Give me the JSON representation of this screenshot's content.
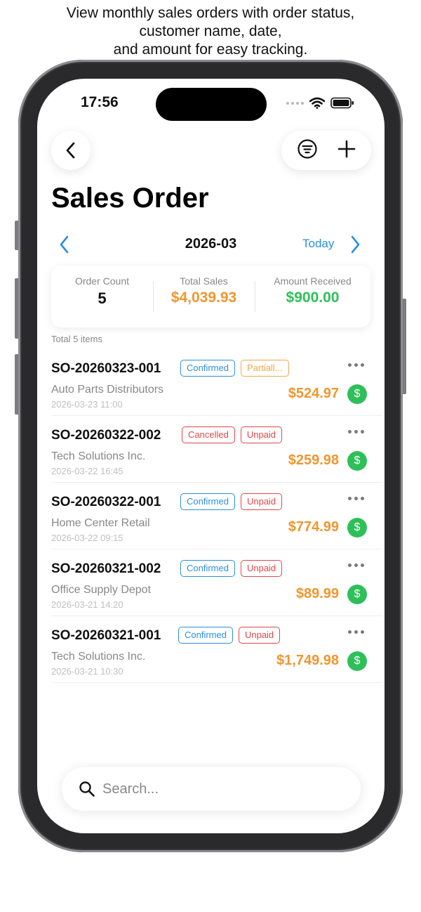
{
  "caption": {
    "line1": "View monthly sales orders with order status,",
    "line2": "customer name, date,",
    "line3": "and amount for easy tracking."
  },
  "status_bar": {
    "time": "17:56",
    "icons": [
      "signal-dots-icon",
      "wifi-icon",
      "battery-icon"
    ]
  },
  "nav": {
    "back_icon": "chevron-left-icon",
    "filter_icon": "filter-icon",
    "add_icon": "plus-icon"
  },
  "page": {
    "title": "Sales Order"
  },
  "month_nav": {
    "label": "2026-03",
    "today": "Today"
  },
  "summary": {
    "order_count_label": "Order Count",
    "order_count": "5",
    "total_sales_label": "Total Sales",
    "total_sales": "$4,039.93",
    "amount_received_label": "Amount Received",
    "amount_received": "$900.00"
  },
  "list": {
    "total": "Total 5 items",
    "orders": [
      {
        "no": "SO-20260323-001",
        "status": "Confirmed",
        "payment": "Partiall...",
        "customer": "Auto Parts Distributors",
        "date": "2026-03-23 11:00",
        "amount": "$524.97"
      },
      {
        "no": "SO-20260322-002",
        "status": "Cancelled",
        "payment": "Unpaid",
        "customer": "Tech Solutions Inc.",
        "date": "2026-03-22 16:45",
        "amount": "$259.98"
      },
      {
        "no": "SO-20260322-001",
        "status": "Confirmed",
        "payment": "Unpaid",
        "customer": "Home Center Retail",
        "date": "2026-03-22 09:15",
        "amount": "$774.99"
      },
      {
        "no": "SO-20260321-002",
        "status": "Confirmed",
        "payment": "Unpaid",
        "customer": "Office Supply Depot",
        "date": "2026-03-21 14:20",
        "amount": "$89.99"
      },
      {
        "no": "SO-20260321-001",
        "status": "Confirmed",
        "payment": "Unpaid",
        "customer": "Tech Solutions Inc.",
        "date": "2026-03-21 10:30",
        "amount": "$1,749.98"
      }
    ]
  },
  "search": {
    "placeholder": "Search..."
  },
  "colors": {
    "accent_blue": "#2b8fe0",
    "sales_orange": "#f0962e",
    "received_green": "#2fbf5a",
    "confirmed": "#2b8fe0",
    "cancelled": "#e2474b",
    "unpaid": "#e2474b",
    "partial": "#f0a84a"
  }
}
